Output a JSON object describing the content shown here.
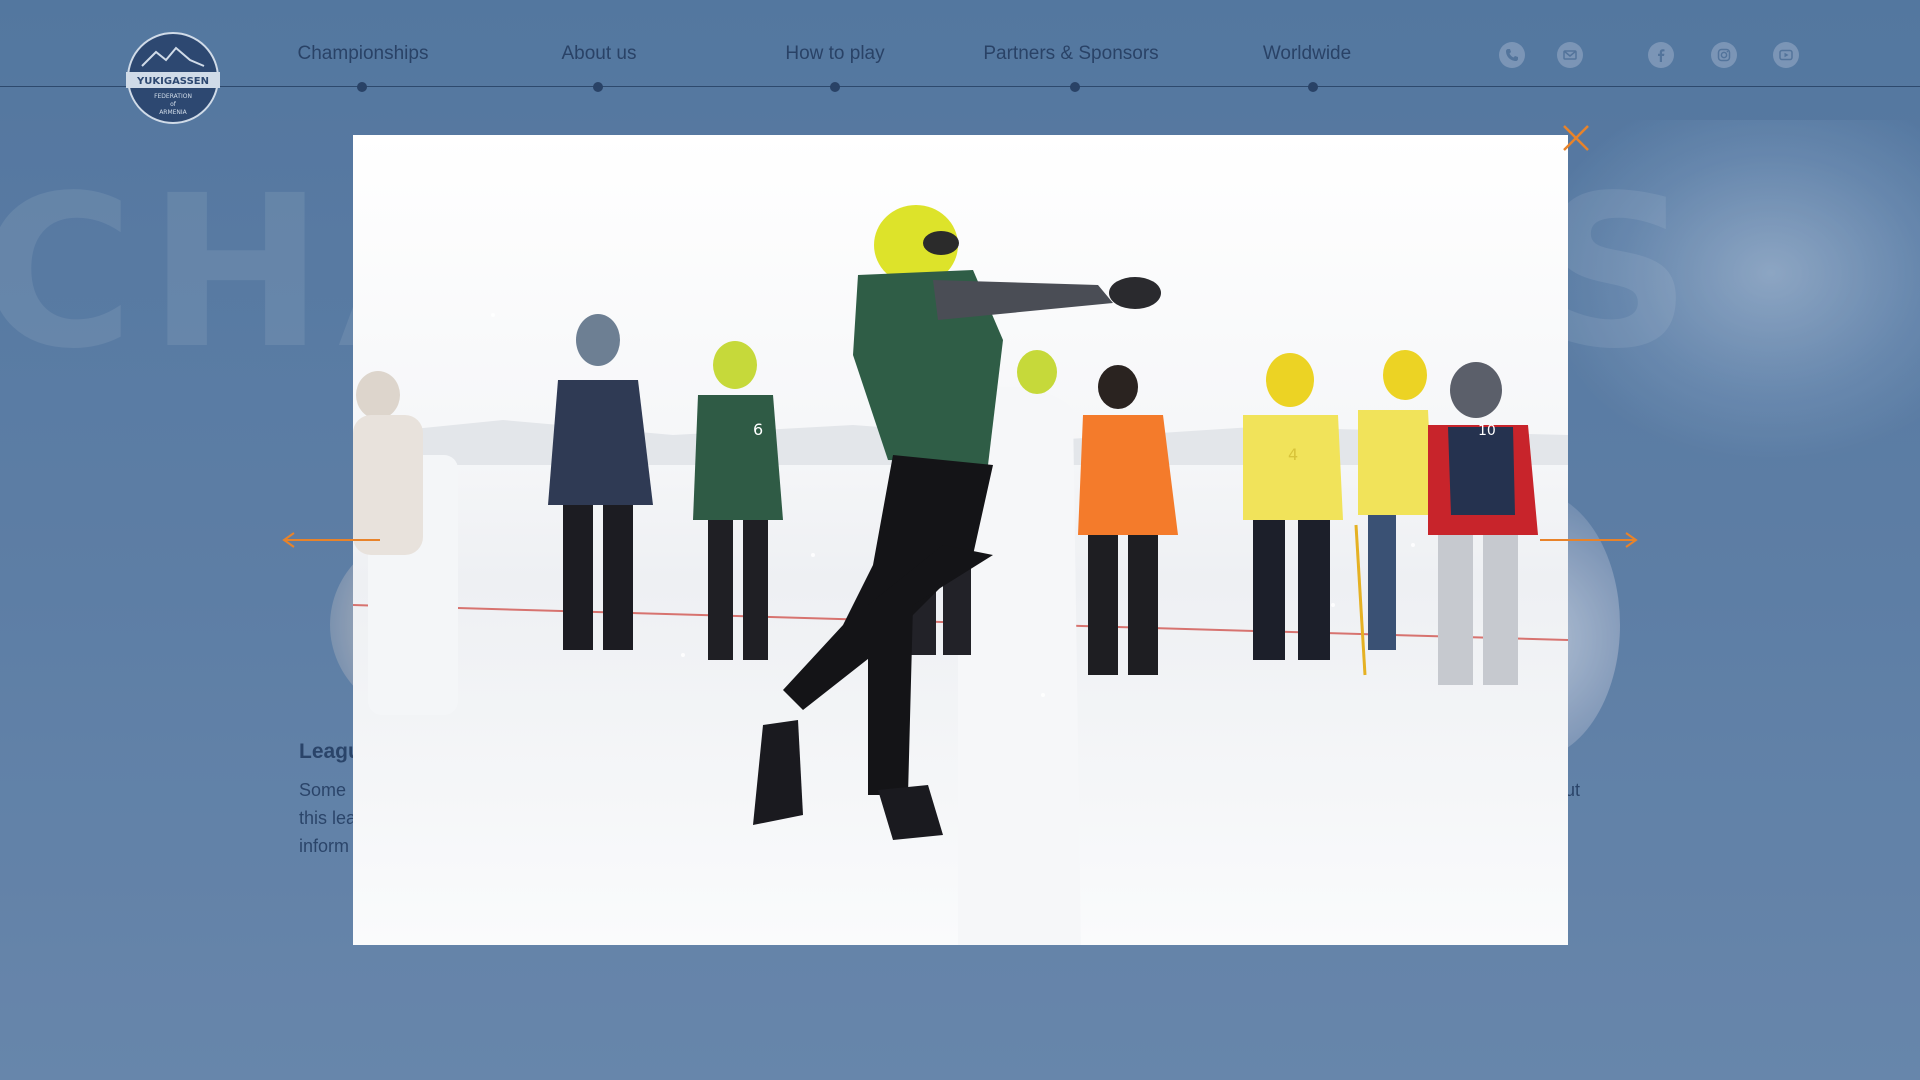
{
  "brand": {
    "logo_line1": "YUKIGASSEN",
    "logo_line2": "FEDERATION",
    "logo_line3": "of",
    "logo_line4": "ARMENIA"
  },
  "nav": {
    "items": [
      {
        "label": "Championships"
      },
      {
        "label": "About us"
      },
      {
        "label": "How to play"
      },
      {
        "label": "Partners & Sponsors"
      },
      {
        "label": "Worldwide"
      }
    ]
  },
  "social": {
    "icons": [
      "phone-icon",
      "mail-icon",
      "facebook-icon",
      "instagram-icon",
      "youtube-icon"
    ]
  },
  "hero": {
    "title_left": "CHA",
    "title_right": "S"
  },
  "cards": {
    "left": {
      "title": "Leagu",
      "text_line1": "Some",
      "text_line2": "this lea",
      "text_line3": "inform"
    },
    "right": {
      "text_fragment": "ut"
    }
  },
  "lightbox": {
    "photo_subject": "yukigassen player throwing a snowball behind a snow shelter, spectators and players in helmets and bibs on snowy field",
    "bib_numbers": [
      "6",
      "4",
      "10"
    ]
  },
  "colors": {
    "accent": "#e8832a",
    "navy": "#1a3256",
    "page_bg": "#5e7fa5",
    "modal_bg": "#fbfcfd"
  }
}
